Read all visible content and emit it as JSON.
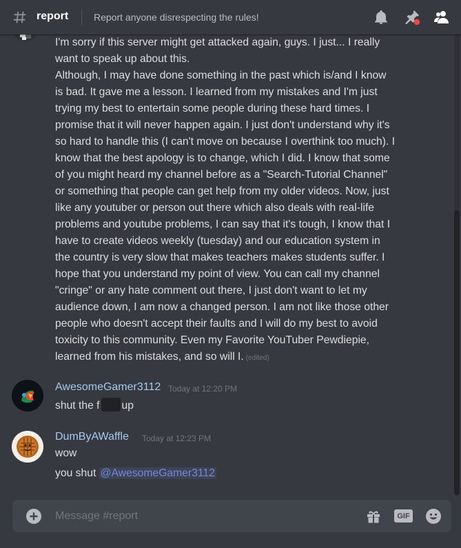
{
  "header": {
    "channel_name": "report",
    "topic": "Report anyone disrespecting the rules!",
    "icons": [
      "hash-icon",
      "bell-icon",
      "pin-icon",
      "members-icon"
    ]
  },
  "messages": {
    "first_message_lines": [
      "I'm sorry if this server might get attacked again, guys. I just... I really",
      "want to speak up about this.",
      "Although, I may have done something in the past which is/and I know",
      "is bad. It gave me a lesson. I learned from my mistakes and I'm just",
      "trying my best to entertain some people during these hard times. I",
      "promise that it will never happen again. I just don't understand why it's",
      "so hard to handle this (I can't move on because I overthink too much). I",
      "know that the best apology is to change, which I did. I know that some",
      "of you might heard my channel before as a \"Search-Tutorial Channel\"",
      "or something that people can get help from my older videos. Now, just",
      "like any youtuber or person out there which also deals with real-life",
      "problems and youtube problems, I can say that it's tough, I know that I",
      "have to create videos weekly (tuesday) and our education system in",
      "the country is very slow that makes teachers makes students suffer. I",
      "hope that you understand my point of view. You can call my channel",
      "\"cringe\" or any hate comment out there, I just don't want to let my",
      "audience down, I am now a changed person. I am not like those other",
      "people who doesn't accept their faults and I will do my best to avoid",
      "toxicity to this community. Even my Favorite YouTuber Pewdiepie,",
      "learned from his mistakes, and so will I."
    ],
    "edited_label": "(edited)",
    "msg2": {
      "author": "AwesomeGamer3112",
      "timestamp": "Today at 12:20 PM",
      "text_before": "shut the f",
      "text_after": "up"
    },
    "msg3": {
      "author": "DumByAWaffle",
      "timestamp": "Today at 12:23 PM",
      "line1": "wow",
      "line2_prefix": "you shut ",
      "mention": "@AwesomeGamer3112"
    }
  },
  "composer": {
    "placeholder": "Message #report",
    "gif_label": "GIF"
  },
  "colors": {
    "background": "#36393f",
    "author": "#a6c8f0",
    "mention": "#7289da",
    "notification_dot": "#f04747"
  }
}
